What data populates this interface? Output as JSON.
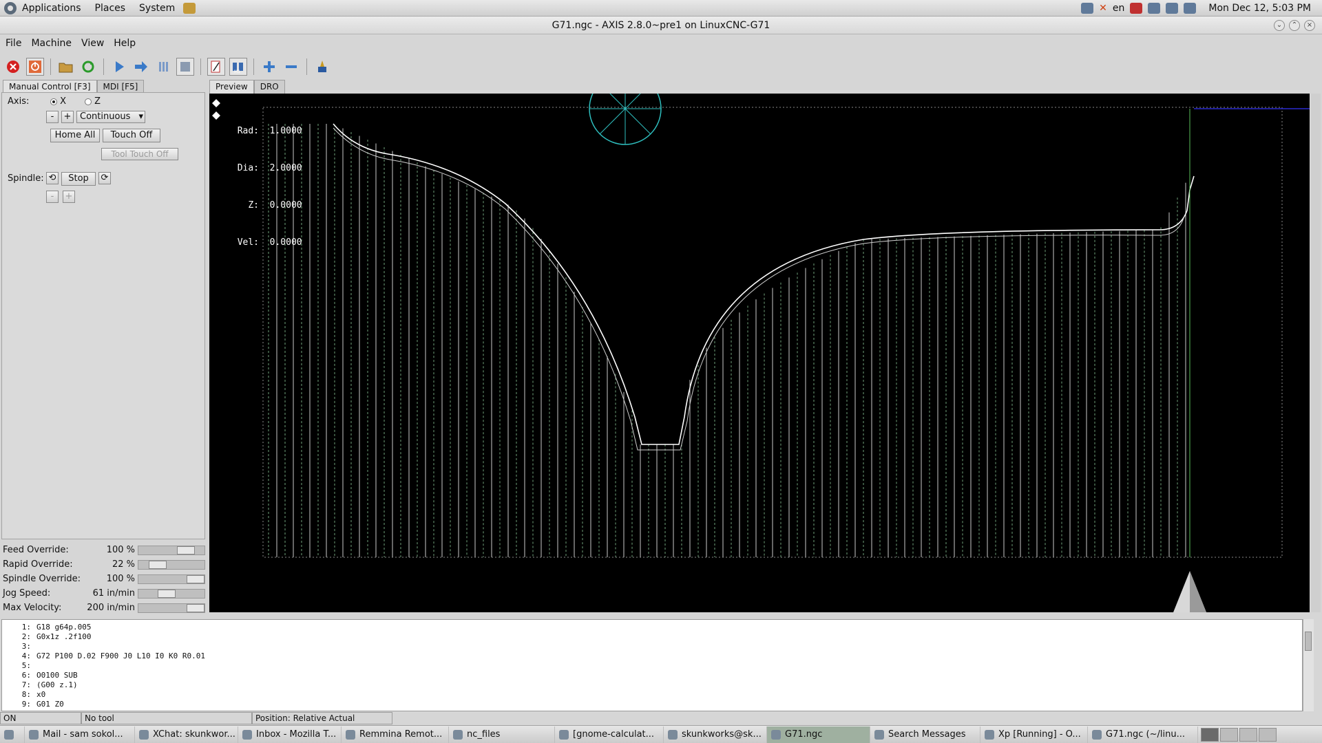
{
  "top_panel": {
    "menus": [
      "Applications",
      "Places",
      "System"
    ],
    "tray": {
      "keyboard": "en",
      "clock": "Mon Dec 12,  5:03 PM"
    }
  },
  "window": {
    "title": "G71.ngc - AXIS 2.8.0~pre1 on LinuxCNC-G71"
  },
  "menubar": {
    "items": [
      "File",
      "Machine",
      "View",
      "Help"
    ]
  },
  "toolbar": {
    "icons": [
      "estop-icon",
      "machine-power-icon",
      "open-file-icon",
      "reload-icon",
      "run-icon",
      "step-icon",
      "pause-icon",
      "stop-icon",
      "block-delete-icon",
      "optional-stop-icon",
      "zoom-in-icon",
      "zoom-out-icon",
      "clear-backplot-icon"
    ]
  },
  "left": {
    "tabs": [
      "Manual Control [F3]",
      "MDI [F5]"
    ],
    "axis_label": "Axis:",
    "axis_options": [
      "X",
      "Z"
    ],
    "axis_selected": "X",
    "jog_minus": "-",
    "jog_plus": "+",
    "jog_increment": "Continuous",
    "home_all": "Home All",
    "touch_off": "Touch Off",
    "tool_touch_off": "Tool Touch Off",
    "spindle_label": "Spindle:",
    "spindle_stop": "Stop",
    "spindle_minus": "-",
    "spindle_plus": "+"
  },
  "overrides": [
    {
      "name": "Feed Override:",
      "value": "100 %",
      "level": 0.8
    },
    {
      "name": "Rapid Override:",
      "value": "22 %",
      "level": 0.22
    },
    {
      "name": "Spindle Override:",
      "value": "100 %",
      "level": 1.0
    },
    {
      "name": "Jog Speed:",
      "value": "61 in/min",
      "level": 0.4
    },
    {
      "name": "Max Velocity:",
      "value": "200 in/min",
      "level": 1.0
    }
  ],
  "preview": {
    "tabs": [
      "Preview",
      "DRO"
    ],
    "dro": [
      {
        "label": "Rad:",
        "value": "1.0000"
      },
      {
        "label": "Dia:",
        "value": "2.0000"
      },
      {
        "label": "Z:",
        "value": "0.0000"
      },
      {
        "label": "Vel:",
        "value": "0.0000"
      }
    ]
  },
  "gcode": [
    {
      "n": "1:",
      "text": "G18 g64p.005"
    },
    {
      "n": "2:",
      "text": "G0x1z .2f100"
    },
    {
      "n": "3:",
      "text": ""
    },
    {
      "n": "4:",
      "text": "G72 P100 D.02 F900 J0 L10 I0 K0 R0.01"
    },
    {
      "n": "5:",
      "text": ""
    },
    {
      "n": "6:",
      "text": "O0100 SUB"
    },
    {
      "n": "7:",
      "text": "(G00 z.1)"
    },
    {
      "n": "8:",
      "text": "x0"
    },
    {
      "n": "9:",
      "text": "G01 Z0"
    }
  ],
  "status": {
    "state": "ON",
    "tool": "No tool",
    "position": "Position: Relative Actual"
  },
  "taskbar": [
    "Mail - sam sokol...",
    "XChat: skunkwor...",
    "Inbox - Mozilla T...",
    "Remmina Remot...",
    "nc_files",
    "[gnome-calculat...",
    "skunkworks@sk...",
    "G71.ngc",
    "Search Messages",
    "Xp [Running] - O...",
    "G71.ngc (~/linu..."
  ],
  "colors": {
    "preview_bg": "#000000",
    "toolpath": "#ffffff",
    "feed_lines": "#8ecb9a",
    "tool_marker": "#2fbfbf"
  }
}
